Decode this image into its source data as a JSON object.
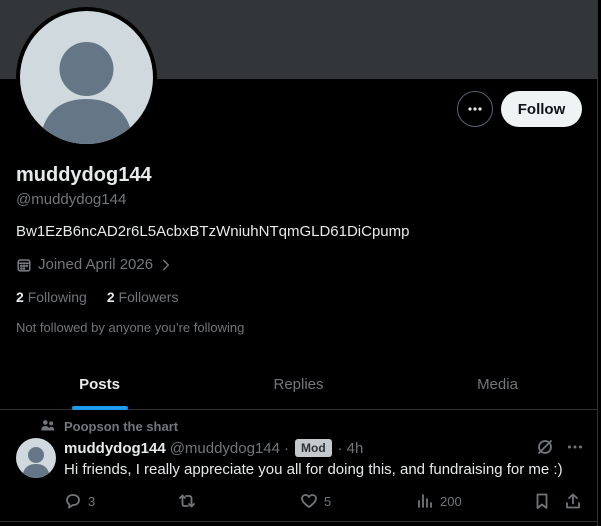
{
  "profile": {
    "display_name": "muddydog144",
    "handle": "@muddydog144",
    "bio": "Bw1EzB6ncAD2r6L5AcbxBTzWniuhNTqmGLD61DiCpump",
    "joined": "Joined April 2026",
    "following_count": "2",
    "following_label": "Following",
    "followers_count": "2",
    "followers_label": "Followers",
    "not_followed_text": "Not followed by anyone you’re following"
  },
  "actions": {
    "follow_label": "Follow",
    "more_icon": "more-horizontal-icon"
  },
  "tabs": [
    {
      "label": "Posts",
      "active": true
    },
    {
      "label": "Replies",
      "active": false
    },
    {
      "label": "Media",
      "active": false
    }
  ],
  "post": {
    "context": "Poopson the shart",
    "author_name": "muddydog144",
    "author_handle": "@muddydog144",
    "separator": "·",
    "badge": "Mod",
    "time": "4h",
    "text": "Hi friends, I really appreciate you all for doing this, and fundraising for me :)",
    "replies": "3",
    "reposts": "",
    "likes": "5",
    "views": "200"
  },
  "colors": {
    "accent": "#1d9bf0",
    "banner": "#333639",
    "background": "#000000",
    "muted_text": "#71767b"
  }
}
